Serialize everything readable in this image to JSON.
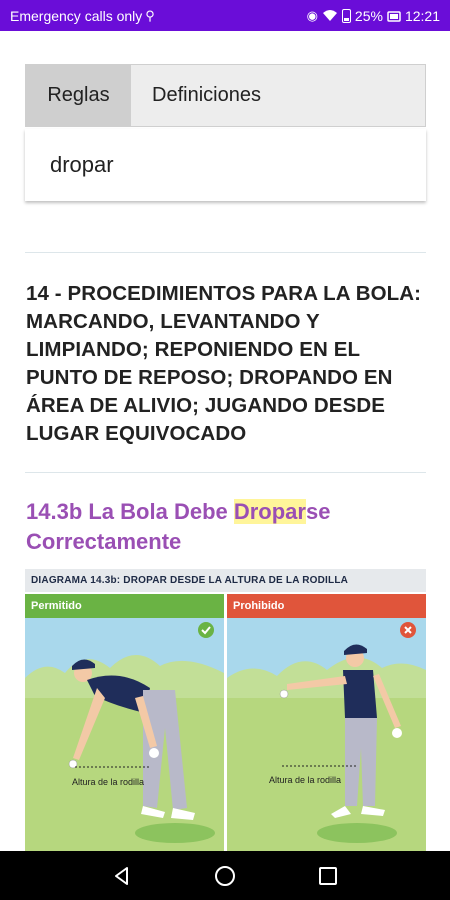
{
  "statusbar": {
    "carrier": "Emergency calls only",
    "battery": "25%",
    "time": "12:21"
  },
  "tabs": [
    {
      "label": "Reglas",
      "active": true
    },
    {
      "label": "Definiciones",
      "active": false
    }
  ],
  "search": {
    "value": "dropar"
  },
  "chapter": {
    "title": "14 - PROCEDIMIENTOS PARA LA BOLA: MARCANDO, LEVANTANDO Y LIMPIANDO; REPONIENDO EN EL PUNTO DE REPOSO; DROPANDO EN ÁREA DE ALIVIO; JUGANDO DESDE LUGAR EQUIVOCADO"
  },
  "section": {
    "prefix": "14.3b La Bola Debe ",
    "highlight": "Dropar",
    "suffix": "se Correctamente"
  },
  "diagram": {
    "header": "DIAGRAMA 14.3b:  DROPAR DESDE LA ALTURA DE LA RODILLA",
    "panels": [
      {
        "label": "Permitido",
        "caption": "Altura de la rodilla",
        "status_color": "#6ab344"
      },
      {
        "label": "Prohibido",
        "caption": "Altura de la rodilla",
        "status_color": "#e0553b"
      }
    ]
  },
  "navbar": {
    "back": "back-icon",
    "home": "home-icon",
    "recents": "recents-icon"
  }
}
